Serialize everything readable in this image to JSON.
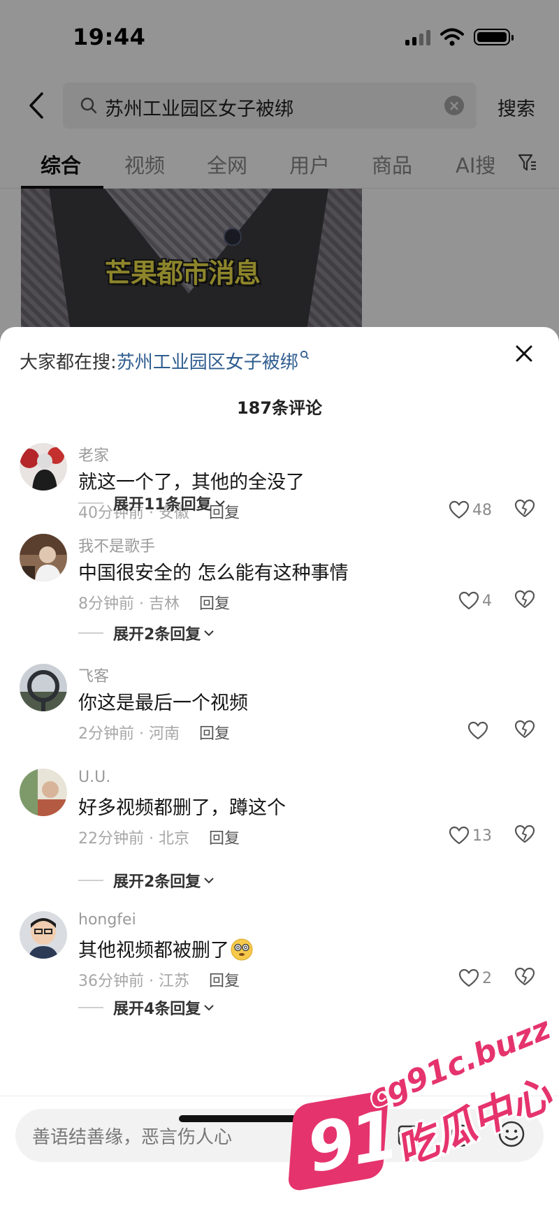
{
  "status_bar": {
    "time": "19:44"
  },
  "search": {
    "query": "苏州工业园区女子被绑",
    "search_button": "搜索"
  },
  "tabs": [
    {
      "label": "综合",
      "active": true
    },
    {
      "label": "视频"
    },
    {
      "label": "全网"
    },
    {
      "label": "用户"
    },
    {
      "label": "商品"
    },
    {
      "label": "AI搜"
    }
  ],
  "video": {
    "caption": "芒果都市消息"
  },
  "sheet": {
    "hot_search_prefix": "大家都在搜:",
    "hot_search_keyword": "苏州工业园区女子被绑",
    "comment_count": "187条评论"
  },
  "comments": [
    {
      "user": "老家",
      "text": "就这一个了，其他的全没了",
      "time_location": "40分钟前 · 安徽",
      "reply": "回复",
      "likes": "48",
      "expand": "展开11条回复"
    },
    {
      "user": "我不是歌手",
      "text": "中国很安全的 怎么能有这种事情",
      "time_location": "8分钟前 · 吉林",
      "reply": "回复",
      "likes": "4",
      "expand": "展开2条回复"
    },
    {
      "user": "飞客",
      "text": "你这是最后一个视频",
      "time_location": "2分钟前 · 河南",
      "reply": "回复",
      "likes": ""
    },
    {
      "user": "U.U.",
      "text": "好多视频都删了，蹲这个",
      "time_location": "22分钟前 · 北京",
      "reply": "回复",
      "likes": "13",
      "expand": "展开2条回复"
    },
    {
      "user": "hongfei",
      "text": "其他视频都被删了",
      "text_emoji": "dizzy-face-emoji",
      "time_location": "36分钟前 · 江苏",
      "reply": "回复",
      "likes": "2",
      "expand": "展开4条回复"
    }
  ],
  "input": {
    "placeholder": "善语结善缘，恶言伤人心"
  },
  "watermark": {
    "number": "91",
    "url": "cg91c.buzz",
    "text": "吃瓜中心"
  },
  "colors": {
    "keyword": "#2f5d8f",
    "watermark": "#e5336d"
  },
  "icons": [
    "back-icon",
    "search-icon",
    "clear-icon",
    "filter-icon",
    "close-icon",
    "heart-icon",
    "dislike-icon",
    "image-icon",
    "at-icon",
    "emoji-icon",
    "chevron-down-icon"
  ]
}
